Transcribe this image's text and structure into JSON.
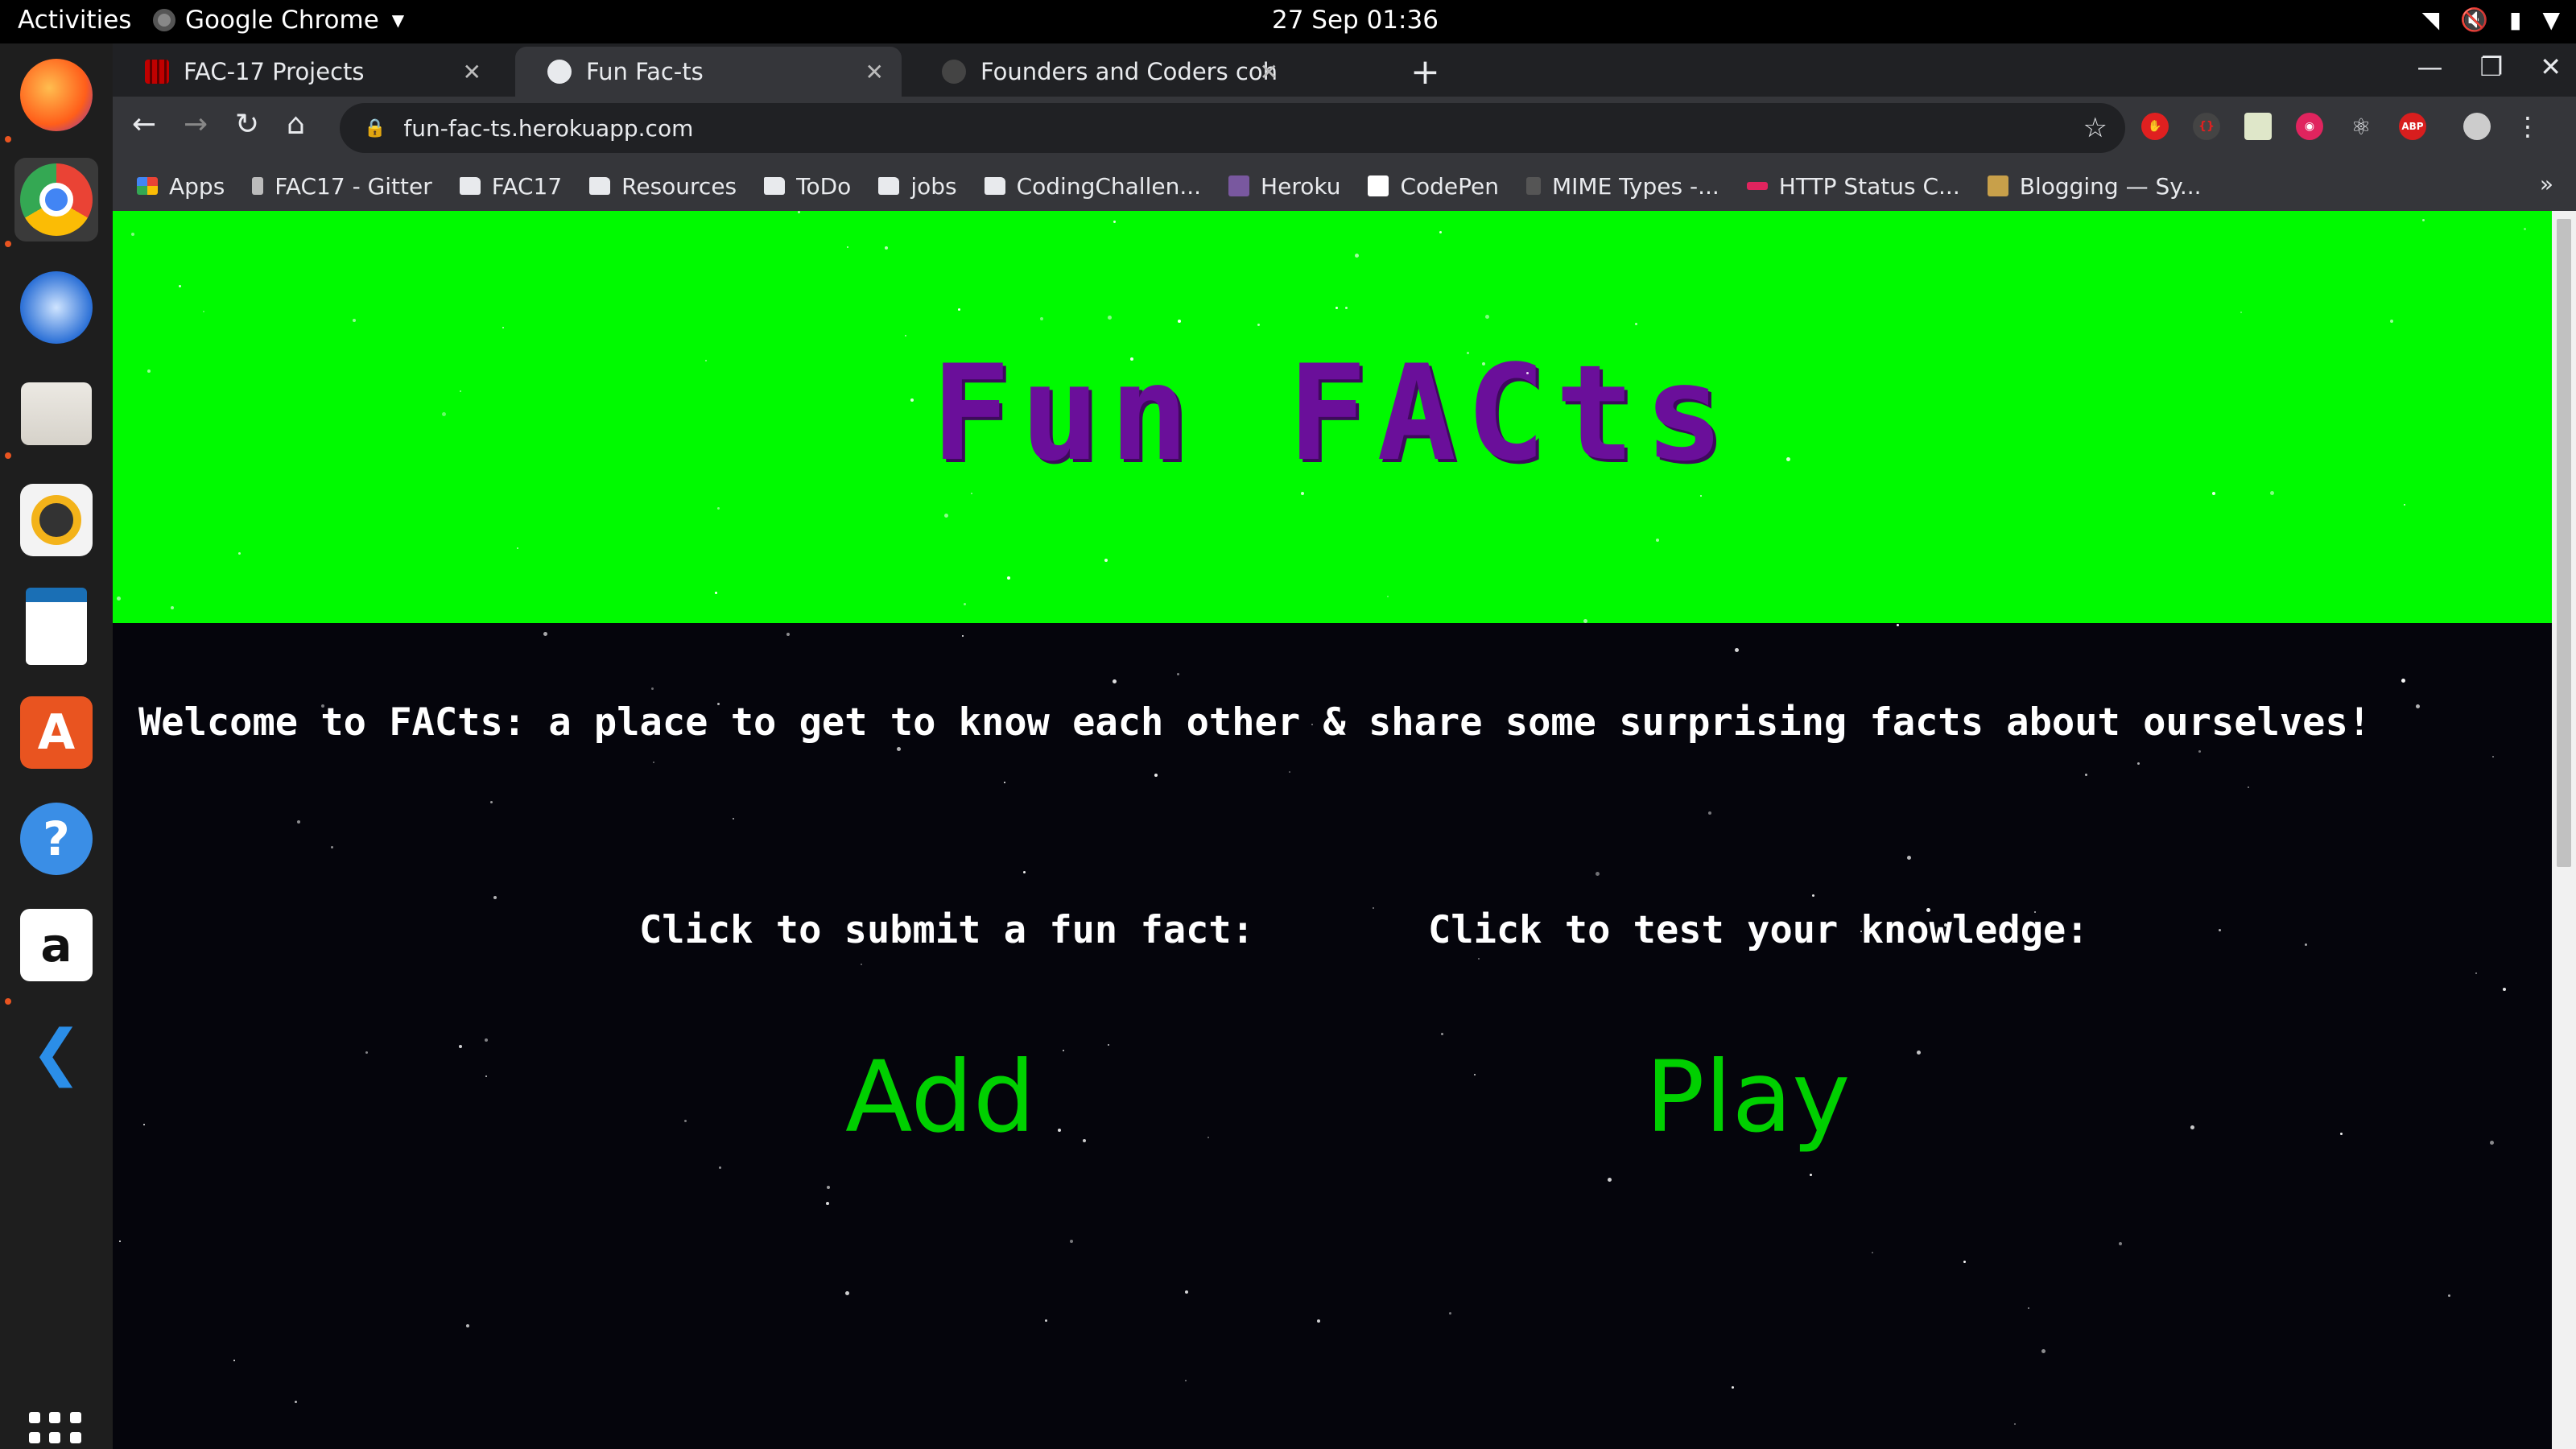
{
  "topbar": {
    "activities": "Activities",
    "app_name": "Google Chrome",
    "clock": "27 Sep  01:36"
  },
  "tabs": [
    {
      "title": "FAC-17 Projects",
      "active": false,
      "favicon_color": "#c00000"
    },
    {
      "title": "Fun Fac-ts",
      "active": true,
      "favicon_color": "#e8eaed"
    },
    {
      "title": "Founders and Coders coh",
      "active": false,
      "favicon_color": "#444444"
    }
  ],
  "omnibox": {
    "url": "fun-fac-ts.herokuapp.com"
  },
  "bookmarks": [
    {
      "label": "Apps",
      "icon": "apps-grid-icon"
    },
    {
      "label": "FAC17 - Gitter",
      "icon": "gitter-icon"
    },
    {
      "label": "FAC17",
      "icon": "folder-icon"
    },
    {
      "label": "Resources",
      "icon": "folder-icon"
    },
    {
      "label": "ToDo",
      "icon": "folder-icon"
    },
    {
      "label": "jobs",
      "icon": "folder-icon"
    },
    {
      "label": "CodingChallen...",
      "icon": "folder-icon"
    },
    {
      "label": "Heroku",
      "icon": "heroku-icon"
    },
    {
      "label": "CodePen",
      "icon": "codepen-icon"
    },
    {
      "label": "MIME Types -...",
      "icon": "mdn-icon"
    },
    {
      "label": "HTTP Status C...",
      "icon": "http-icon"
    },
    {
      "label": "Blogging — Sy...",
      "icon": "syn-icon"
    }
  ],
  "page": {
    "title": "Fun FACts",
    "welcome": "Welcome to FACts: a place to get to know each other & share some surprising facts about ourselves!",
    "submit_prompt": "Click to submit a fun fact:",
    "test_prompt": "Click to test your knowledge:",
    "add_label": "Add",
    "play_label": "Play"
  },
  "colors": {
    "hero_bg": "#00fa00",
    "title": "#6a0f9a",
    "link": "#00d000",
    "content_bg": "#05050c"
  }
}
